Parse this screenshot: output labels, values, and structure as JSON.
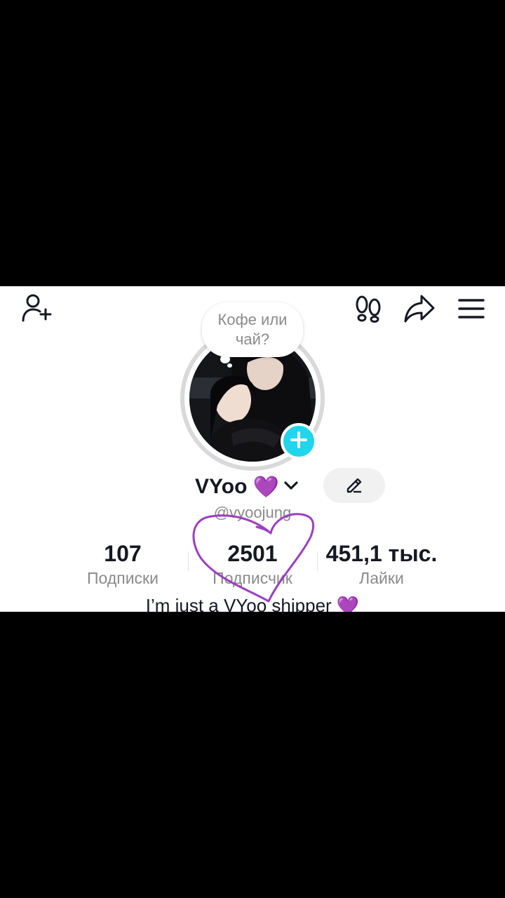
{
  "profile": {
    "bubble_text": "Кофе или чай?",
    "name": "VYoo",
    "name_emoji": "💜",
    "handle": "@vyoojung",
    "bio": "I’m just a VYoo shipper 💜"
  },
  "stats": [
    {
      "value": "107",
      "label": "Подписки"
    },
    {
      "value": "2501",
      "label": "Подписчик"
    },
    {
      "value": "451,1 тыс.",
      "label": "Лайки"
    }
  ],
  "icons": {
    "add_friend": "add-user-icon",
    "footprints": "footprints-icon",
    "share": "share-arrow-icon",
    "menu": "hamburger-menu-icon",
    "edit": "pencil-icon",
    "dropdown": "chevron-down-icon",
    "add_story": "plus-icon"
  },
  "colors": {
    "accent": "#20d5ec",
    "heart_doodle": "#9b3fc1",
    "text": "#161823",
    "muted": "#8a8a8a"
  }
}
